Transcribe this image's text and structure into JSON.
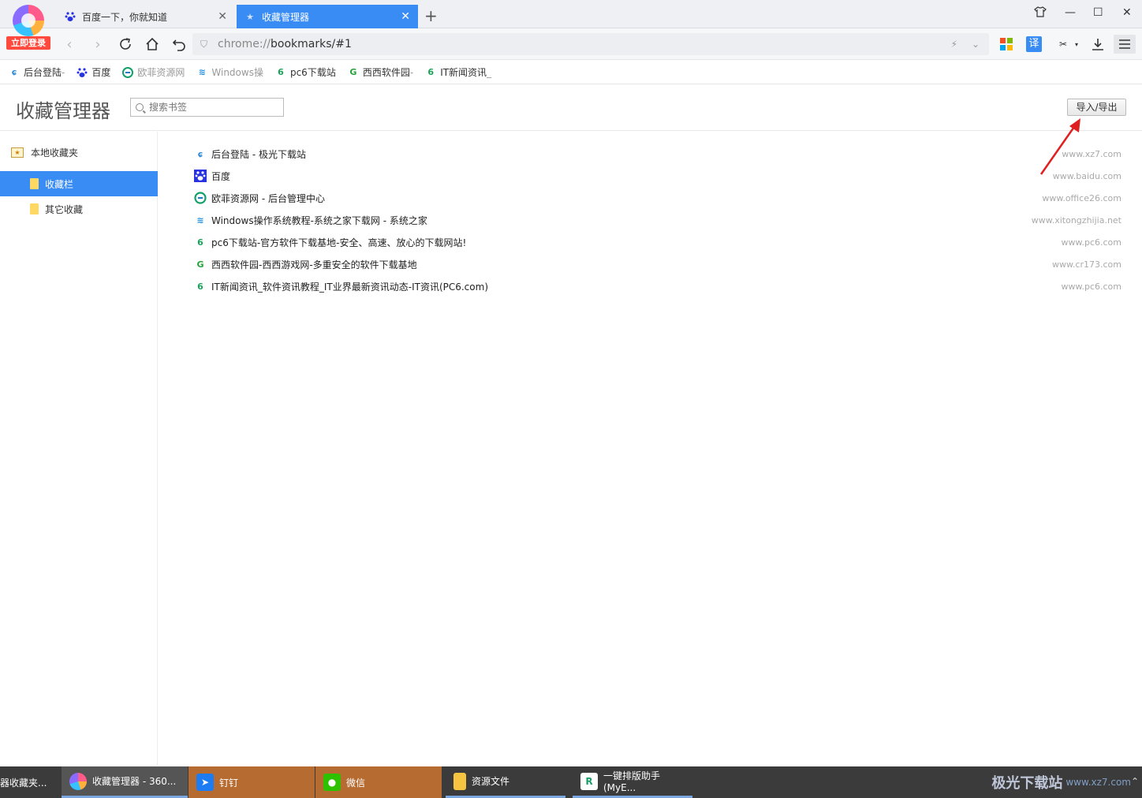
{
  "browser": {
    "login_label": "立即登录",
    "tabs": [
      {
        "label": "百度一下，你就知道",
        "icon": "baidu-paw-icon"
      },
      {
        "label": "收藏管理器",
        "icon": "star-icon"
      }
    ],
    "new_tab_glyph": "+",
    "url_scheme": "chrome://",
    "url_path": "bookmarks/#1",
    "translate_label": "译"
  },
  "bookmark_bar": [
    {
      "label": "后台登陆",
      "tail": " -",
      "icon": "xz7-icon"
    },
    {
      "label": "百度",
      "tail": "",
      "icon": "baidu-paw-icon"
    },
    {
      "label": "欧菲资源网",
      "tail": "",
      "icon": "office26-icon"
    },
    {
      "label": "Windows操",
      "tail": "",
      "icon": "xitongzhijia-icon"
    },
    {
      "label": "pc6下载站",
      "tail": "",
      "icon": "pc6-icon"
    },
    {
      "label": "西西软件园",
      "tail": "-",
      "icon": "cr173-icon"
    },
    {
      "label": "IT新闻资讯",
      "tail": "_",
      "icon": "pc6-icon"
    }
  ],
  "manager": {
    "title": "收藏管理器",
    "search_placeholder": "搜索书签",
    "import_export_label": "导入/导出",
    "tree": {
      "root": "本地收藏夹",
      "folders": [
        {
          "label": "收藏栏",
          "selected": true
        },
        {
          "label": "其它收藏",
          "selected": false
        }
      ]
    },
    "bookmarks": [
      {
        "title": "后台登陆 - 极光下载站",
        "domain": "www.xz7.com",
        "icon": "xz7-icon"
      },
      {
        "title": "百度",
        "domain": "www.baidu.com",
        "icon": "baidu-paw-icon"
      },
      {
        "title": "欧菲资源网 - 后台管理中心",
        "domain": "www.office26.com",
        "icon": "office26-icon"
      },
      {
        "title": "Windows操作系统教程-系统之家下载网 - 系统之家",
        "domain": "www.xitongzhijia.net",
        "icon": "xitongzhijia-icon"
      },
      {
        "title": "pc6下载站-官方软件下载基地-安全、高速、放心的下载网站!",
        "domain": "www.pc6.com",
        "icon": "pc6-icon"
      },
      {
        "title": "西西软件园-西西游戏网-多重安全的软件下载基地",
        "domain": "www.cr173.com",
        "icon": "cr173-icon"
      },
      {
        "title": "IT新闻资讯_软件资讯教程_IT业界最新资讯动态-IT资讯(PC6.com)",
        "domain": "www.pc6.com",
        "icon": "pc6-icon"
      }
    ]
  },
  "taskbar": {
    "items": [
      {
        "label": "器收藏夹...",
        "icon": "",
        "style": "plain"
      },
      {
        "label": "收藏管理器 - 360...",
        "icon": "360-browser-icon",
        "style": "active"
      },
      {
        "label": "钉钉",
        "icon": "dingtalk-icon",
        "style": "orange"
      },
      {
        "label": "微信",
        "icon": "wechat-icon",
        "style": "orange"
      },
      {
        "label": "资源文件",
        "icon": "folder-icon",
        "style": "plain"
      },
      {
        "label": "一键排版助手(MyE...",
        "icon": "myeditor-icon",
        "style": "plain"
      }
    ],
    "watermark_title": "极光下载站",
    "watermark_url": "www.xz7.com"
  },
  "colors": {
    "accent": "#3a8cf5",
    "annotation_arrow": "#e02020",
    "taskbar_orange": "#b66b30"
  }
}
